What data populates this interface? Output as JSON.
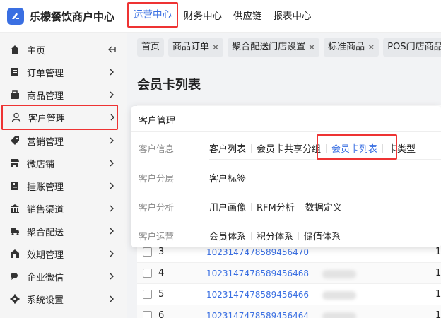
{
  "brand": {
    "name": "乐檬餐饮商户中心"
  },
  "topnav": [
    "运营中心",
    "财务中心",
    "供应链",
    "报表中心"
  ],
  "sidebar": {
    "items": [
      {
        "label": "主页",
        "icon": "home-icon"
      },
      {
        "label": "订单管理",
        "icon": "order-icon"
      },
      {
        "label": "商品管理",
        "icon": "product-icon"
      },
      {
        "label": "客户管理",
        "icon": "user-icon"
      },
      {
        "label": "营销管理",
        "icon": "tag-icon"
      },
      {
        "label": "微店铺",
        "icon": "store-icon"
      },
      {
        "label": "挂账管理",
        "icon": "ledger-icon"
      },
      {
        "label": "销售渠道",
        "icon": "channel-icon"
      },
      {
        "label": "聚合配送",
        "icon": "delivery-icon"
      },
      {
        "label": "效期管理",
        "icon": "expiry-icon"
      },
      {
        "label": "企业微信",
        "icon": "wechat-icon"
      },
      {
        "label": "系统设置",
        "icon": "gear-icon"
      }
    ]
  },
  "tabs": [
    "首页",
    "商品订单",
    "聚合配送门店设置",
    "标准商品",
    "POS门店商品"
  ],
  "page": {
    "title": "会员卡列表"
  },
  "dropdown": {
    "title": "客户管理",
    "rows": [
      {
        "category": "客户信息",
        "links": [
          "客户列表",
          "会员卡共享分组",
          "会员卡列表",
          "卡类型"
        ]
      },
      {
        "category": "客户分层",
        "links": [
          "客户标签"
        ]
      },
      {
        "category": "客户分析",
        "links": [
          "用户画像",
          "RFM分析",
          "数据定义"
        ]
      },
      {
        "category": "客户运营",
        "links": [
          "会员体系",
          "积分体系",
          "储值体系"
        ]
      }
    ]
  },
  "table": {
    "rows": [
      {
        "num": "3",
        "code": "102314747858945647​0",
        "trail": "1"
      },
      {
        "num": "4",
        "code": "1023147478589456468",
        "trail": "1"
      },
      {
        "num": "5",
        "code": "1023147478589456466",
        "trail": "1"
      },
      {
        "num": "6",
        "code": "1023147478589456464",
        "trail": "1"
      }
    ]
  },
  "colors": {
    "accent": "#3a6fe2",
    "highlight": "#ee3333"
  }
}
